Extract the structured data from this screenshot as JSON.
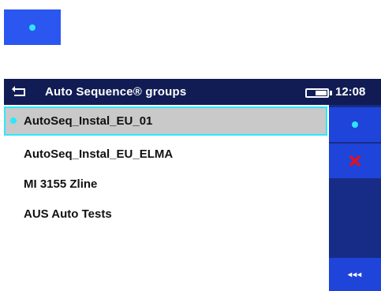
{
  "header": {
    "title": "Auto Sequence® groups",
    "time": "12:08"
  },
  "groups": [
    {
      "label": "AutoSeq_Instal_EU_01",
      "selected": true
    },
    {
      "label": "AutoSeq_Instal_EU_ELMA",
      "selected": false
    },
    {
      "label": "MI 3155 Zline",
      "selected": false
    },
    {
      "label": "AUS Auto Tests",
      "selected": false
    }
  ],
  "sidebar": {
    "buttons": [
      {
        "icon": "select-dot-icon"
      },
      {
        "icon": "delete-x-icon"
      },
      {
        "icon": "more-options-icon",
        "text": "◂◂◂"
      }
    ]
  },
  "colors": {
    "accent": "#2ee6ff",
    "header_bg": "#111c55",
    "button_bg": "#1f44d9",
    "delete": "#e01020"
  }
}
